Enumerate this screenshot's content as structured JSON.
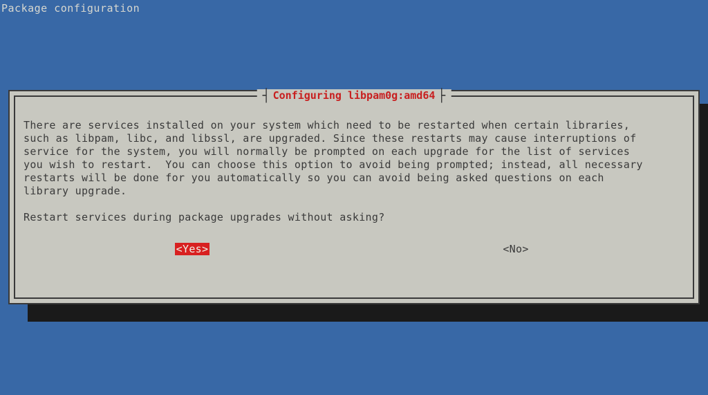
{
  "header": {
    "title": "Package configuration"
  },
  "dialog": {
    "title": "Configuring libpam0g:amd64",
    "body": "There are services installed on your system which need to be restarted when certain libraries,\nsuch as libpam, libc, and libssl, are upgraded. Since these restarts may cause interruptions of\nservice for the system, you will normally be prompted on each upgrade for the list of services\nyou wish to restart.  You can choose this option to avoid being prompted; instead, all necessary\nrestarts will be done for you automatically so you can avoid being asked questions on each\nlibrary upgrade.",
    "question": "Restart services during package upgrades without asking?",
    "yes_label": "<Yes>",
    "no_label": "<No>"
  },
  "colors": {
    "background": "#3868a6",
    "dialog_bg": "#c8c8c0",
    "title_red": "#c82020",
    "button_red": "#d82020",
    "text_dark": "#3a3a3a"
  }
}
